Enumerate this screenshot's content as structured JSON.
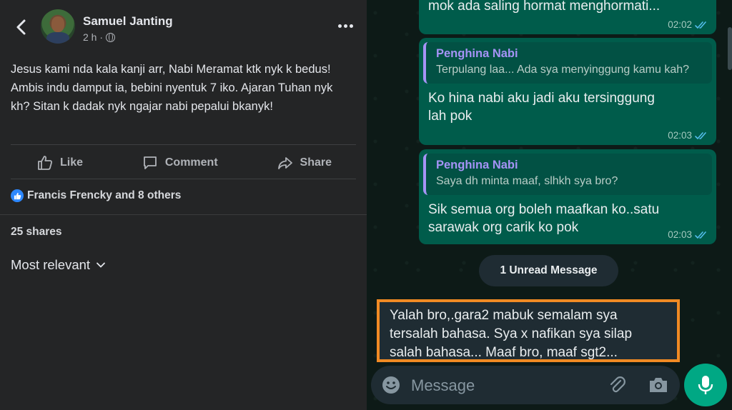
{
  "facebook": {
    "author": "Samuel Janting",
    "time": "2 h ·",
    "post_text": "Jesus kami nda kala kanji arr, Nabi Meramat ktk nyk k bedus! Ambis indu damput ia, bebini nyentuk 7 iko. Ajaran Tuhan nyk kh? Sitan k dadak nyk ngajar nabi pepalui bkanyk!",
    "actions": {
      "like": "Like",
      "comment": "Comment",
      "share": "Share"
    },
    "reactions": "Francis Frencky and 8 others",
    "shares": "25 shares",
    "sort": "Most relevant"
  },
  "whatsapp": {
    "messages": [
      {
        "text": "mok ada saling hormat menghormati...",
        "time": "02:02"
      },
      {
        "quote_name": "Penghina Nabi",
        "quote_text": "Terpulang laa... Ada sya menyinggung kamu kah?",
        "text": "Ko hina nabi aku jadi aku tersinggung lah pok",
        "time": "02:03"
      },
      {
        "quote_name": "Penghina Nabi",
        "quote_text": "Saya dh minta maaf, slhkh sya bro?",
        "text": "Sik semua org boleh maafkan ko..satu sarawak org carik ko pok",
        "time": "02:03"
      }
    ],
    "unread_label": "1 Unread Message",
    "incoming_message": "Yalah bro,.gara2 mabuk semalam sya tersalah bahasa. Sya x nafikan sya silap salah bahasa... Maaf bro, maaf sgt2...",
    "input_placeholder": "Message",
    "colors": {
      "bubble_out": "#005c4b",
      "quote_accent": "#a593f6",
      "highlight_border": "#f08a24",
      "mic_button": "#00a884"
    }
  }
}
